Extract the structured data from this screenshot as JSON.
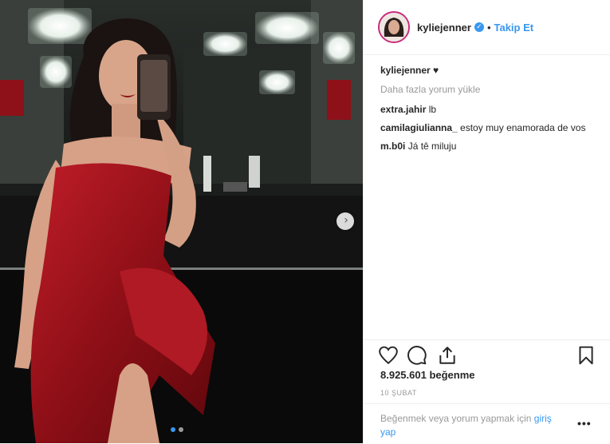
{
  "post": {
    "username": "kyliejenner",
    "verified_icon": "verified-badge-icon",
    "separator": "•",
    "follow_label": "Takip Et",
    "caption_user": "kyliejenner",
    "caption_text": "♥",
    "load_more": "Daha fazla yorum yükle",
    "comments": [
      {
        "user": "extra.jahir",
        "text": "lb"
      },
      {
        "user": "camilagiulianna_",
        "text": "estoy muy enamorada de vos"
      },
      {
        "user": "m.b0i",
        "text": "Já tê miluju"
      }
    ],
    "likes": "8.925.601 beğenme",
    "date": "10 ŞUBAT",
    "login_prompt": "Beğenmek veya yorum yapmak için",
    "login_link": "giriş yap",
    "more_label": "•••",
    "icons": {
      "like": "heart-icon",
      "comment": "comment-icon",
      "share": "share-icon",
      "save": "bookmark-icon",
      "next": "chevron-right-icon"
    },
    "carousel": {
      "total": 2,
      "active": 1
    },
    "colors": {
      "accent": "#3897f0",
      "text": "#262626",
      "muted": "#999999",
      "dress": "#a3141c"
    }
  }
}
